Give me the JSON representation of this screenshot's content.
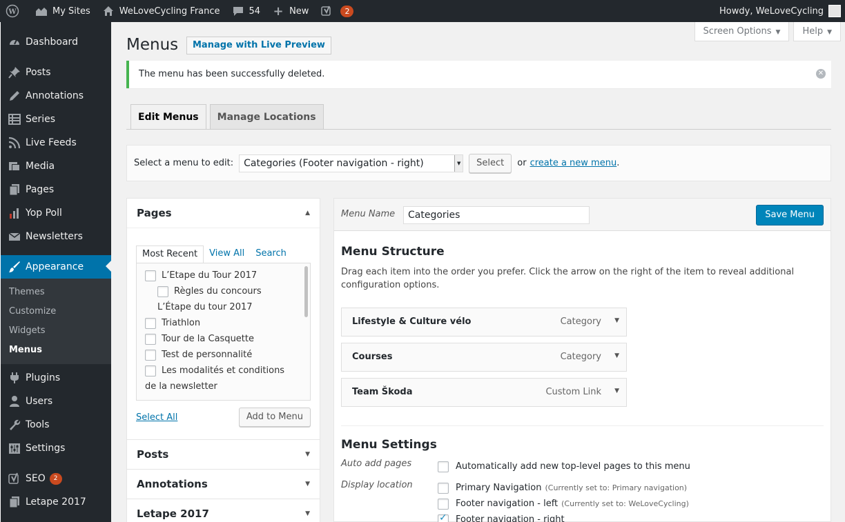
{
  "adminbar": {
    "my_sites": "My Sites",
    "site_name": "WeLoveCycling France",
    "comments_count": "54",
    "new_label": "New",
    "seo_badge": "2",
    "howdy": "Howdy, WeLoveCycling"
  },
  "sidebar": {
    "items": [
      {
        "label": "Dashboard",
        "icon": "dashboard-icon"
      },
      {
        "label": "Posts",
        "icon": "pin-icon"
      },
      {
        "label": "Annotations",
        "icon": "pencil-icon"
      },
      {
        "label": "Series",
        "icon": "grid-icon"
      },
      {
        "label": "Live Feeds",
        "icon": "rss-icon"
      },
      {
        "label": "Media",
        "icon": "media-icon"
      },
      {
        "label": "Pages",
        "icon": "pages-icon"
      },
      {
        "label": "Yop Poll",
        "icon": "poll-icon"
      },
      {
        "label": "Newsletters",
        "icon": "mail-icon"
      },
      {
        "label": "Appearance",
        "icon": "brush-icon"
      }
    ],
    "appearance_sub": [
      "Themes",
      "Customize",
      "Widgets",
      "Menus"
    ],
    "items_after": [
      {
        "label": "Plugins",
        "icon": "plug-icon"
      },
      {
        "label": "Users",
        "icon": "user-icon"
      },
      {
        "label": "Tools",
        "icon": "wrench-icon"
      },
      {
        "label": "Settings",
        "icon": "sliders-icon"
      }
    ],
    "seo_label": "SEO",
    "seo_badge": "2",
    "letape_label": "Letape 2017"
  },
  "header": {
    "screen_options": "Screen Options",
    "help": "Help",
    "title": "Menus",
    "live_preview": "Manage with Live Preview"
  },
  "notice": {
    "text": "The menu has been successfully deleted."
  },
  "tabs": {
    "edit": "Edit Menus",
    "locations": "Manage Locations"
  },
  "select_bar": {
    "label": "Select a menu to edit:",
    "selected": "Categories (Footer navigation - right)",
    "button": "Select",
    "or": "or",
    "create_link": "create a new menu",
    "period": "."
  },
  "accordion": {
    "pages_title": "Pages",
    "sub_tabs": [
      "Most Recent",
      "View All",
      "Search"
    ],
    "pages": [
      {
        "label": "L’Etape du Tour 2017",
        "level": 0,
        "checkbox": true
      },
      {
        "label": "Règles du concours",
        "level": 1,
        "checkbox": true
      },
      {
        "label": "L’Étape du tour 2017",
        "level": 1,
        "checkbox": false
      },
      {
        "label": "Triathlon",
        "level": 0,
        "checkbox": true
      },
      {
        "label": "Tour de la Casquette",
        "level": 0,
        "checkbox": true
      },
      {
        "label": "Test de personnalité",
        "level": 0,
        "checkbox": true
      },
      {
        "label": "Les modalités et conditions",
        "level": 0,
        "checkbox": true
      },
      {
        "label": "de la newsletter",
        "level": -1,
        "checkbox": false
      }
    ],
    "select_all": "Select All",
    "add_to_menu": "Add to Menu",
    "posts_title": "Posts",
    "annotations_title": "Annotations",
    "letape_title": "Letape 2017"
  },
  "menu_mgmt": {
    "name_label": "Menu Name",
    "name_value": "Categories",
    "save": "Save Menu",
    "structure_title": "Menu Structure",
    "structure_desc": "Drag each item into the order you prefer. Click the arrow on the right of the item to reveal additional configuration options.",
    "items": [
      {
        "title": "Lifestyle & Culture vélo",
        "type": "Category"
      },
      {
        "title": "Courses",
        "type": "Category"
      },
      {
        "title": "Team Škoda",
        "type": "Custom Link"
      }
    ],
    "settings_title": "Menu Settings",
    "auto_add_label": "Auto add pages",
    "auto_add_text": "Automatically add new top-level pages to this menu",
    "display_location_label": "Display location",
    "locations": [
      {
        "name": "Primary Navigation",
        "note": "(Currently set to: Primary navigation)",
        "checked": false
      },
      {
        "name": "Footer navigation - left",
        "note": "(Currently set to: WeLoveCycling)",
        "checked": false
      },
      {
        "name": "Footer navigation - right",
        "note": "",
        "checked": true
      }
    ]
  }
}
